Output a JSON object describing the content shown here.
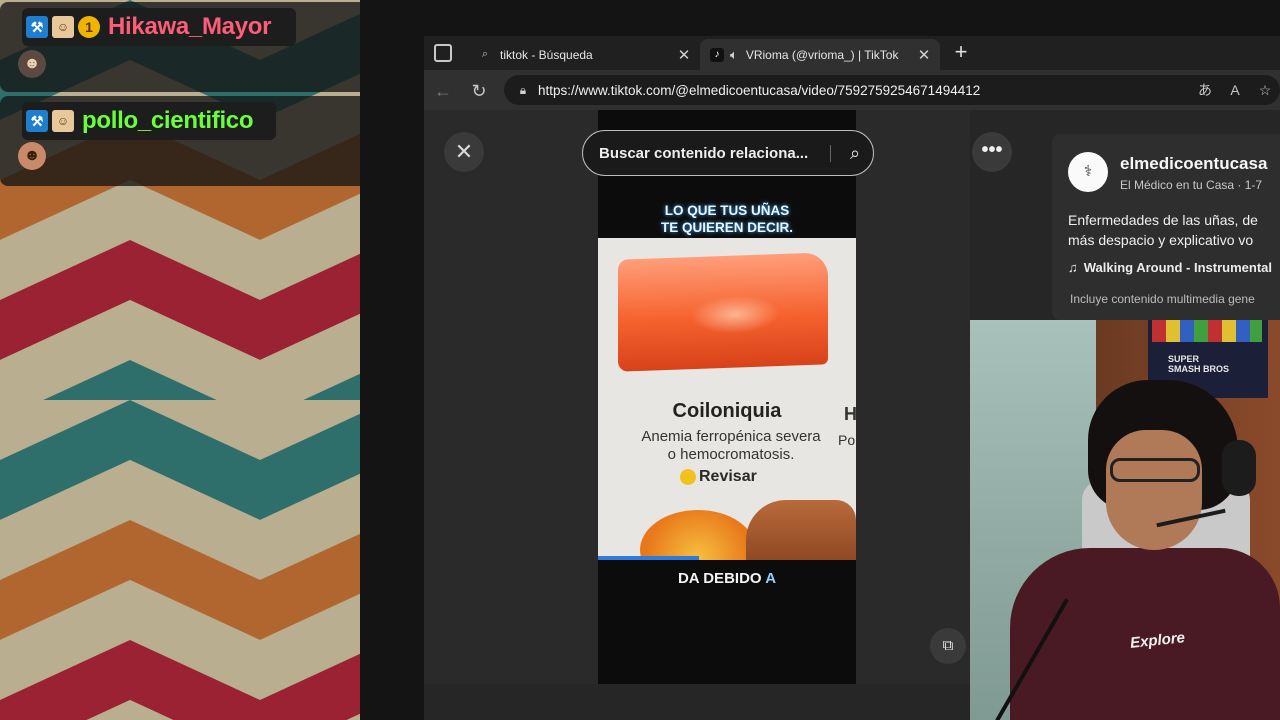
{
  "chat": {
    "messages": [
      {
        "username": "Hikawa_Mayor",
        "color": "#ff5c7a",
        "badges": [
          "moderator-badge",
          "face-badge",
          "coin-badge"
        ],
        "coin_badge_text": "1",
        "emote": "face-emote"
      },
      {
        "username": "pollo_cientifico",
        "color": "#6aff3c",
        "badges": [
          "moderator-badge",
          "face-badge"
        ],
        "emote": "face-emote"
      }
    ]
  },
  "browser": {
    "tabs": [
      {
        "title": "tiktok - Búsqueda",
        "icon": "search-icon",
        "active": false
      },
      {
        "title": "VRioma (@vrioma_) | TikTok",
        "icon": "tiktok-icon",
        "audio": true,
        "active": true
      }
    ],
    "new_tab_label": "+",
    "url": "https://www.tiktok.com/@elmedicoentucasa/video/7592759254671494412"
  },
  "tiktok": {
    "search_placeholder": "Buscar contenido relaciona...",
    "video": {
      "top_caption_line1": "LO QUE TUS UÑAS",
      "top_caption_line2": "TE QUIEREN DECIR.",
      "card_title": "Coiloniquia",
      "card_desc_line1": "Anemia ferropénica severa",
      "card_desc_line2": "o hemocromatosis.",
      "card_check": "Revisar",
      "side_title": "H",
      "side_desc": "Po",
      "bottom_caption": "DA DEBIDO",
      "bottom_caption_accent": "A",
      "progress": 0.39
    },
    "account": {
      "name": "elmedicoentucasa",
      "subtitle": "El Médico en tu Casa · 1-7",
      "description_line1": "Enfermedades de las uñas, de",
      "description_line2": "más despacio y explicativo vo",
      "music": "Walking Around - Instrumental",
      "includes": "Incluye contenido multimedia gene"
    }
  },
  "webcam": {
    "poster_text_line1": "SUPER",
    "poster_text_line2": "SMASH BROS",
    "shirt_logo": "Explore"
  }
}
